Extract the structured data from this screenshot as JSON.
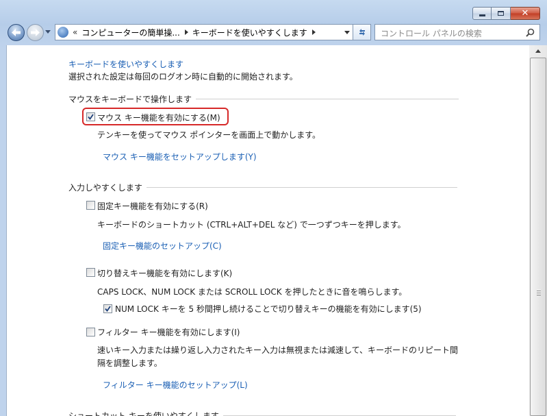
{
  "window": {
    "caption_buttons": [
      "minimize",
      "maximize",
      "close"
    ]
  },
  "navbar": {
    "address_chevron": "«",
    "breadcrumb": [
      "コンピューターの簡単操...",
      "キーボードを使いやすくします"
    ],
    "search_placeholder": "コントロール パネルの検索"
  },
  "page": {
    "title": "キーボードを使いやすくします",
    "subtitle": "選択された設定は毎回のログオン時に自動的に開始されます。"
  },
  "sections": {
    "mouse": {
      "heading": "マウスをキーボードで操作します",
      "checkbox_label": "マウス キー機能を有効にする(M)",
      "checked": true,
      "description": "テンキーを使ってマウス ポインターを画面上で動かします。",
      "setup_link": "マウス キー機能をセットアップします(Y)"
    },
    "typing": {
      "heading": "入力しやすくします",
      "sticky": {
        "checkbox_label": "固定キー機能を有効にする(R)",
        "checked": false,
        "description": "キーボードのショートカット (CTRL+ALT+DEL など) で一つずつキーを押します。",
        "setup_link": "固定キー機能のセットアップ(C)"
      },
      "toggle": {
        "checkbox_label": "切り替えキー機能を有効にします(K)",
        "checked": false,
        "description": "CAPS LOCK、NUM LOCK または SCROLL LOCK を押したときに音を鳴らします。",
        "sub_checkbox_label": "NUM LOCK キーを 5 秒間押し続けることで切り替えキーの機能を有効にします(5)",
        "sub_checked": true
      },
      "filter": {
        "checkbox_label": "フィルター キー機能を有効にします(I)",
        "checked": false,
        "description_line1": "速いキー入力または繰り返し入力されたキー入力は無視または減速して、キーボードのリピート間",
        "description_line2": "隔を調整します。",
        "setup_link": "フィルター キー機能のセットアップ(L)"
      }
    },
    "shortcuts": {
      "heading": "ショートカット キーを使いやすくします"
    }
  },
  "colors": {
    "link": "#1a5fb4",
    "highlight_outline": "#d62828",
    "frame": "#bfd3ec"
  }
}
